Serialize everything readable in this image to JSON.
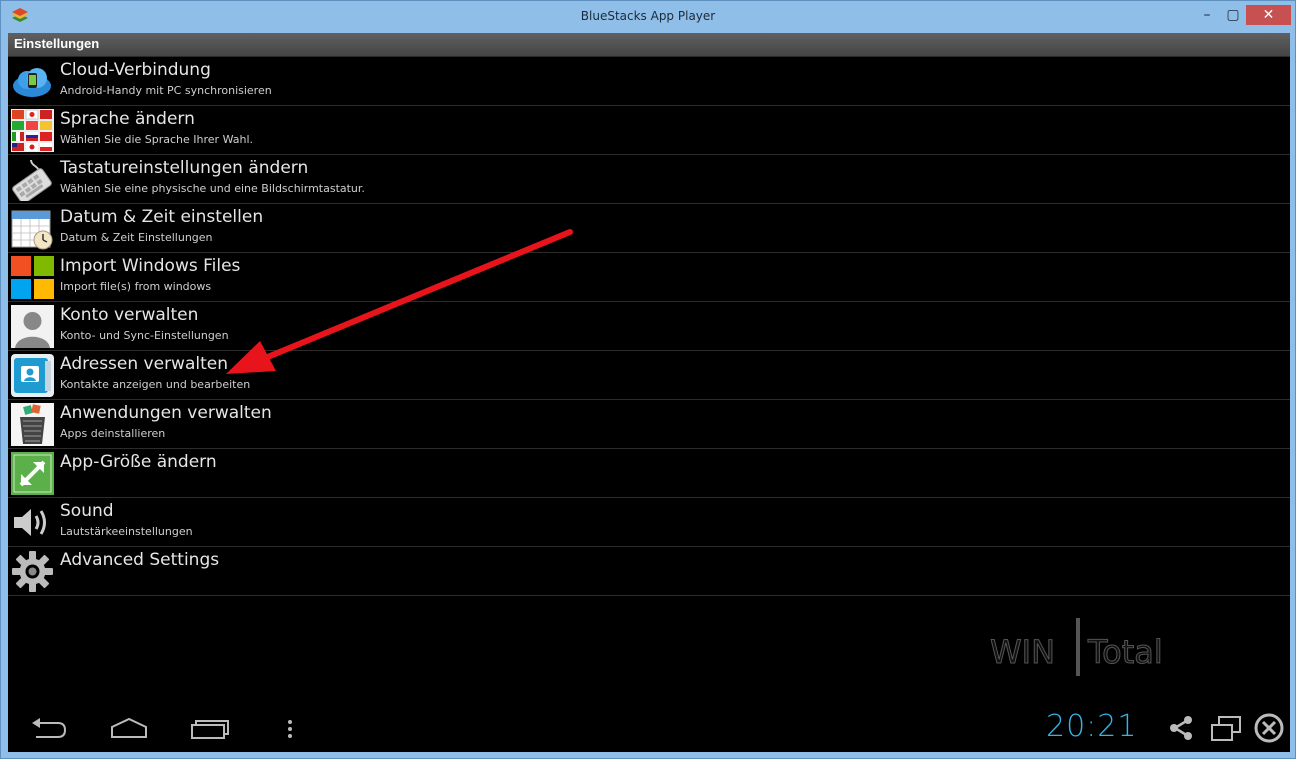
{
  "window": {
    "title": "BlueStacks App Player",
    "minimize": "–",
    "maximize": "▢",
    "close": "✕"
  },
  "actionbar": {
    "title": "Einstellungen"
  },
  "settings": [
    {
      "title": "Cloud-Verbindung",
      "subtitle": "Android-Handy mit PC synchronisieren",
      "icon": "cloud-icon"
    },
    {
      "title": "Sprache ändern",
      "subtitle": "Wählen Sie die Sprache Ihrer Wahl.",
      "icon": "flags-icon"
    },
    {
      "title": "Tastatureinstellungen ändern",
      "subtitle": "Wählen Sie eine physische und eine Bildschirmtastatur.",
      "icon": "keyboard-icon"
    },
    {
      "title": "Datum & Zeit einstellen",
      "subtitle": "Datum & Zeit Einstellungen",
      "icon": "calendar-clock-icon"
    },
    {
      "title": "Import Windows Files",
      "subtitle": "Import file(s) from windows",
      "icon": "windows-logo-icon"
    },
    {
      "title": "Konto verwalten",
      "subtitle": "Konto- und Sync-Einstellungen",
      "icon": "user-avatar-icon"
    },
    {
      "title": "Adressen verwalten",
      "subtitle": "Kontakte anzeigen und bearbeiten",
      "icon": "contacts-icon"
    },
    {
      "title": "Anwendungen verwalten",
      "subtitle": "Apps deinstallieren",
      "icon": "trash-bin-icon"
    },
    {
      "title": "App-Größe ändern",
      "subtitle": "",
      "icon": "resize-arrow-icon"
    },
    {
      "title": "Sound",
      "subtitle": "Lautstärkeeinstellungen",
      "icon": "speaker-icon"
    },
    {
      "title": "Advanced Settings",
      "subtitle": "",
      "icon": "gear-icon"
    }
  ],
  "watermark": {
    "text_left": "WIN",
    "text_right": "Total"
  },
  "statusbar": {
    "clock": "20:21"
  },
  "colors": {
    "accent": "#33b5e5",
    "arrow": "#e8141c",
    "titlebar": "#8fbfe8"
  }
}
